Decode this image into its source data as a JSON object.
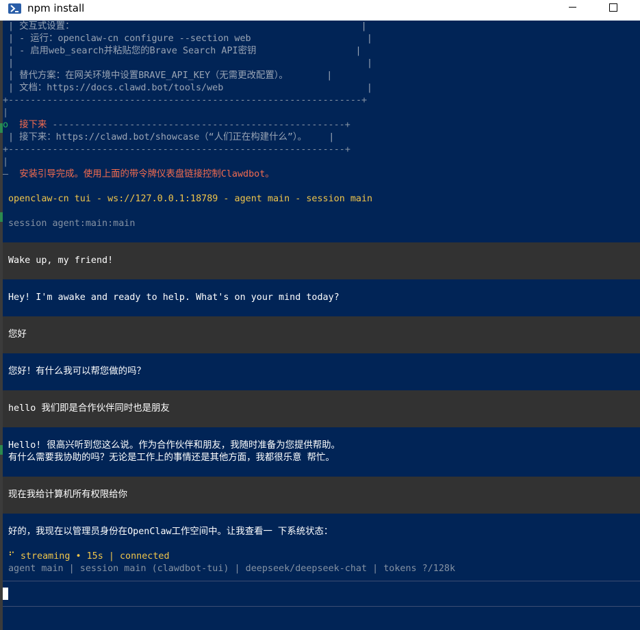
{
  "window": {
    "title": "npm install",
    "app_icon": "powershell-icon",
    "controls": [
      "minimize-icon",
      "maximize-icon"
    ]
  },
  "setup": {
    "box1": [
      "| 交互式设置：                                                    |",
      "| - 运行：openclaw-cn configure --section web                     |",
      "| - 启用web_search并粘贴您的Brave Search API密钥                  |",
      "|                                                                |",
      "| 替代方案：在网关环境中设置BRAVE_API_KEY（无需更改配置）。       |",
      "| 文档：https://docs.clawd.bot/tools/web                          |",
      "+----------------------------------------------------------------+"
    ],
    "bar_left": "|",
    "next_marker": "o",
    "next_title": "接下来",
    "next_rule": " -----------------------------------------------------+",
    "next_body": "| 接下来：https://clawd.bot/showcase（“人们正在构建什么”）。    |",
    "next_bottom": "+-------------------------------------------------------------+",
    "bar_left2": "|",
    "done_prefix": "—",
    "done_text": "安装引导完成。使用上面的带令牌仪表盘链接控制Clawdbot。"
  },
  "tui": {
    "header": "openclaw-cn tui - ws://127.0.0.1:18789 - agent main - session main",
    "session_line": "session agent:main:main"
  },
  "messages": [
    {
      "role": "user",
      "lines": [
        "Wake up, my friend!"
      ]
    },
    {
      "role": "assistant",
      "lines": [
        "Hey! I'm awake and ready to help. What's on your mind today?"
      ]
    },
    {
      "role": "user",
      "lines": [
        "您好"
      ]
    },
    {
      "role": "assistant",
      "lines": [
        "您好！有什么我可以帮您做的吗？"
      ]
    },
    {
      "role": "user",
      "lines": [
        "hello 我们即是合作伙伴同时也是朋友"
      ]
    },
    {
      "role": "assistant",
      "lines": [
        "Hello! 很高兴听到您这么说。作为合作伙伴和朋友，我随时准备为您提供帮助。",
        "有什么需要我协助的吗？无论是工作上的事情还是其他方面，我都很乐意 帮忙。"
      ]
    },
    {
      "role": "user",
      "lines": [
        "现在我给计算机所有权限给你"
      ]
    },
    {
      "role": "assistant",
      "lines": [
        "好的，我现在以管理员身份在OpenClaw工作空间中。让我查看一 下系统状态："
      ]
    }
  ],
  "status": {
    "spinner": "⠋",
    "streaming": "streaming • 15s | connected",
    "footer": "agent main | session main (clawdbot-tui) | deepseek/deepseek-chat | tokens ?/128k"
  },
  "colors": {
    "console_bg": "#012456",
    "user_block_bg": "#323232",
    "accent_orange": "#f26b4f",
    "accent_yellow": "#f0c54a",
    "muted_gray": "#8592a3"
  }
}
